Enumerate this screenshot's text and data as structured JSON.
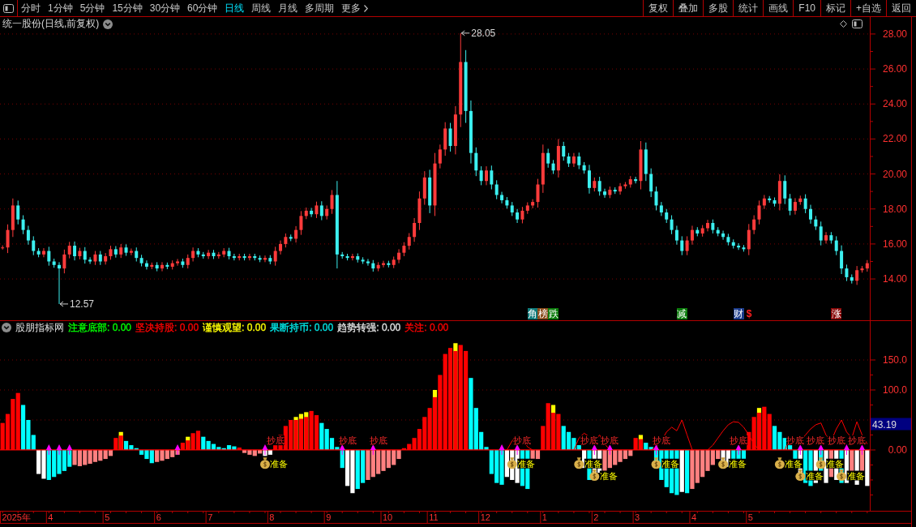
{
  "toolbar": {
    "periods": [
      {
        "label": "分时",
        "selected": false
      },
      {
        "label": "1分钟",
        "selected": false
      },
      {
        "label": "5分钟",
        "selected": false
      },
      {
        "label": "15分钟",
        "selected": false
      },
      {
        "label": "30分钟",
        "selected": false
      },
      {
        "label": "60分钟",
        "selected": false
      },
      {
        "label": "日线",
        "selected": true
      },
      {
        "label": "周线",
        "selected": false
      },
      {
        "label": "月线",
        "selected": false
      },
      {
        "label": "多周期",
        "selected": false
      }
    ],
    "more": {
      "label": "更多"
    },
    "actions": [
      "复权",
      "叠加",
      "多股",
      "统计",
      "画线",
      "F10",
      "标记",
      "+自选",
      "返回"
    ]
  },
  "price_panel": {
    "title": "统一股份(日线,前复权)",
    "extremes": [
      {
        "kind": "high",
        "label": "28.05"
      },
      {
        "kind": "low",
        "label": "12.57"
      }
    ],
    "events": [
      {
        "kind": "tag",
        "label": "角",
        "color": "#0f7a7a"
      },
      {
        "kind": "tag",
        "label": "榜",
        "color": "#8a4b1a"
      },
      {
        "kind": "tag",
        "label": "跌",
        "color": "#0a7a0a"
      },
      {
        "kind": "tag",
        "label": "减",
        "color": "#0a7a0a"
      },
      {
        "kind": "tag",
        "label": "财",
        "color": "#1a3a8a"
      },
      {
        "kind": "symbol",
        "label": "$",
        "color": "#ff2020"
      },
      {
        "kind": "tag",
        "label": "涨",
        "color": "#8a0a0a"
      }
    ],
    "axis_labels": [
      "28.00",
      "26.00",
      "24.00",
      "22.00",
      "20.00",
      "18.00",
      "16.00",
      "14.00"
    ]
  },
  "indicator_panel": {
    "name": "股朋指标网",
    "legend": [
      {
        "label": "注意底部:",
        "value": "0.00",
        "color": "#00ff00"
      },
      {
        "label": "坚决持股:",
        "value": "0.00",
        "color": "#ff0000"
      },
      {
        "label": "谨慎观望:",
        "value": "0.00",
        "color": "#ffff00"
      },
      {
        "label": "果断持币:",
        "value": "0.00",
        "color": "#00e5e5"
      },
      {
        "label": "趋势转强:",
        "value": "0.00",
        "color": "#e0e0e0"
      },
      {
        "label": "关注:",
        "value": "0.00",
        "color": "#ff0000"
      }
    ],
    "axis_labels": [
      "150.0",
      "100.0",
      "0.00"
    ],
    "current_value": "43.19",
    "signals": [
      {
        "kind": "label",
        "label": "抄底"
      },
      {
        "kind": "label",
        "label": "抄底"
      },
      {
        "kind": "label",
        "label": "抄底"
      },
      {
        "kind": "label",
        "label": "抄底"
      },
      {
        "kind": "label",
        "label": "抄底"
      },
      {
        "kind": "label",
        "label": "抄底"
      },
      {
        "kind": "label",
        "label": "抄底"
      },
      {
        "kind": "label",
        "label": "抄底"
      },
      {
        "kind": "label",
        "label": "抄底"
      },
      {
        "kind": "label",
        "label": "抄底"
      },
      {
        "kind": "label",
        "label": "抄底"
      },
      {
        "kind": "label",
        "label": "抄底"
      },
      {
        "kind": "bag",
        "label": "准备"
      },
      {
        "kind": "bag",
        "label": "准备"
      },
      {
        "kind": "bag",
        "label": "准备"
      },
      {
        "kind": "bag",
        "label": "准备"
      },
      {
        "kind": "bag",
        "label": "准备"
      },
      {
        "kind": "bag",
        "label": "准备"
      },
      {
        "kind": "bag",
        "label": "准备"
      },
      {
        "kind": "bag",
        "label": "准备"
      },
      {
        "kind": "bag",
        "label": "准备"
      },
      {
        "kind": "bag",
        "label": "准备"
      }
    ]
  },
  "time_axis": [
    "2025年",
    "4",
    "5",
    "6",
    "7",
    "8",
    "9",
    "10",
    "11",
    "12",
    "1",
    "2",
    "3",
    "4",
    "5"
  ]
}
